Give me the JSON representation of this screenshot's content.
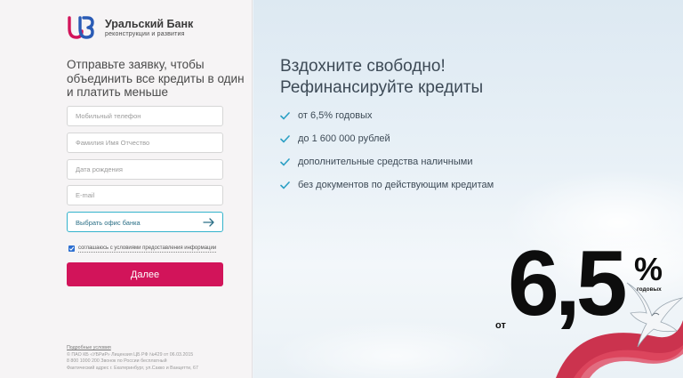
{
  "brand": {
    "name": "Уральский Банк",
    "subtitle": "реконструкции и развития",
    "colors": {
      "primary": "#d2145a",
      "accent": "#34b3cc",
      "logo_red": "#d2145a",
      "logo_blue": "#2a5bb5"
    }
  },
  "form": {
    "title": "Отправьте заявку, чтобы объединить все кредиты в один и платить меньше",
    "fields": {
      "phone_placeholder": "Мобильный телефон",
      "name_placeholder": "Фамилия Имя Отчество",
      "birthdate_placeholder": "Дата рождения",
      "email_placeholder": "E-mail"
    },
    "office_select_label": "Выбрать офис банка",
    "consent_text": "соглашаюсь с условиями предоставления информации",
    "consent_checked": true,
    "submit_label": "Далее"
  },
  "legal": {
    "details_link": "Подробные условия",
    "lines": [
      "© ПАО КБ «УБРиР» Лицензия ЦБ РФ №429 от 06.03.2015",
      "8 800 1000 200 Звонок по России бесплатный",
      "Фактический адрес г. Екатеринбург, ул.Сакко и Ванцетти, 67"
    ]
  },
  "promo": {
    "headline_line1": "Вздохните свободно!",
    "headline_line2": "Рефинансируйте кредиты",
    "benefits": [
      "от 6,5% годовых",
      "до 1 600 000 рублей",
      "дополнительные средства наличными",
      "без документов по действующим кредитам"
    ],
    "rate_prefix": "от",
    "rate_value": "6,5",
    "rate_percent": "%",
    "rate_suffix": "годовых"
  }
}
